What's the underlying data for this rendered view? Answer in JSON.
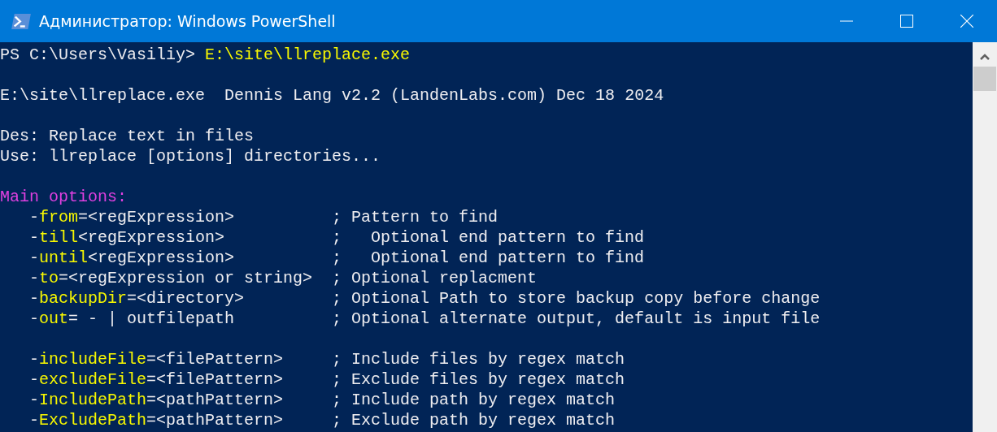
{
  "window": {
    "title": "Администратор: Windows PowerShell"
  },
  "terminal": {
    "blocks": [
      {
        "lines": [
          {
            "segments": [
              {
                "text": "PS C:\\Users\\Vasiliy>",
                "kind": "plain"
              },
              {
                "text": "E:\\site\\llreplace.exe",
                "kind": "command"
              }
            ]
          }
        ]
      },
      {
        "lines": [
          {
            "segments": [
              {
                "text": "E:\\site\\llreplace.exe  Dennis Lang v2.2 (LandenLabs.com) Dec 18 2024",
                "kind": "plain"
              }
            ]
          }
        ]
      },
      {
        "lines": [
          {
            "segments": [
              {
                "text": "Des: Replace text in files",
                "kind": "plain"
              }
            ]
          },
          {
            "segments": [
              {
                "text": "Use: llreplace [options] directories...",
                "kind": "plain"
              }
            ]
          }
        ]
      },
      {
        "lines": [
          {
            "segments": [
              {
                "text": "Main options:",
                "kind": "heading"
              }
            ]
          },
          {
            "option": true,
            "segments": [
              {
                "text": "-",
                "kind": "plain"
              },
              {
                "text": "from",
                "kind": "flag"
              },
              {
                "text": "=<regExpression>",
                "kind": "plain"
              }
            ],
            "comment": "; Pattern to find"
          },
          {
            "option": true,
            "segments": [
              {
                "text": "-",
                "kind": "plain"
              },
              {
                "text": "till",
                "kind": "flag"
              },
              {
                "text": "<regExpression>",
                "kind": "plain"
              }
            ],
            "comment": ";   Optional end pattern to find"
          },
          {
            "option": true,
            "segments": [
              {
                "text": "-",
                "kind": "plain"
              },
              {
                "text": "until",
                "kind": "flag"
              },
              {
                "text": "<regExpression>",
                "kind": "plain"
              }
            ],
            "comment": ";   Optional end pattern to find"
          },
          {
            "option": true,
            "segments": [
              {
                "text": "-",
                "kind": "plain"
              },
              {
                "text": "to",
                "kind": "flag"
              },
              {
                "text": "=<regExpression or string>",
                "kind": "plain"
              }
            ],
            "comment": "; Optional replacment"
          },
          {
            "option": true,
            "segments": [
              {
                "text": "-",
                "kind": "plain"
              },
              {
                "text": "backupDir",
                "kind": "flag"
              },
              {
                "text": "=<directory>",
                "kind": "plain"
              }
            ],
            "comment": "; Optional Path to store backup copy before change"
          },
          {
            "option": true,
            "segments": [
              {
                "text": "-",
                "kind": "plain"
              },
              {
                "text": "out",
                "kind": "flag"
              },
              {
                "text": "= - | outfilepath",
                "kind": "plain"
              }
            ],
            "comment": "; Optional alternate output, default is input file"
          }
        ]
      },
      {
        "lines": [
          {
            "option": true,
            "segments": [
              {
                "text": "-",
                "kind": "plain"
              },
              {
                "text": "includeFile",
                "kind": "flag"
              },
              {
                "text": "=<filePattern>",
                "kind": "plain"
              }
            ],
            "comment": "; Include files by regex match"
          },
          {
            "option": true,
            "segments": [
              {
                "text": "-",
                "kind": "plain"
              },
              {
                "text": "excludeFile",
                "kind": "flag"
              },
              {
                "text": "=<filePattern>",
                "kind": "plain"
              }
            ],
            "comment": "; Exclude files by regex match"
          },
          {
            "option": true,
            "segments": [
              {
                "text": "-",
                "kind": "plain"
              },
              {
                "text": "IncludePath",
                "kind": "flag"
              },
              {
                "text": "=<pathPattern>",
                "kind": "plain"
              }
            ],
            "comment": "; Include path by regex match"
          },
          {
            "option": true,
            "segments": [
              {
                "text": "-",
                "kind": "plain"
              },
              {
                "text": "ExcludePath",
                "kind": "flag"
              },
              {
                "text": "=<pathPattern>",
                "kind": "plain"
              }
            ],
            "comment": "; Exclude path by regex match"
          }
        ]
      }
    ]
  }
}
